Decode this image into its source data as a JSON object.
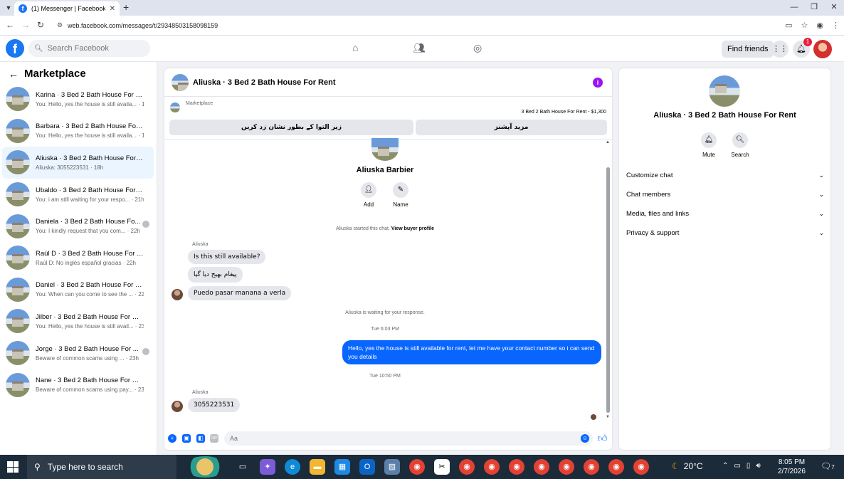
{
  "browser": {
    "tab_title": "(1) Messenger | Facebook",
    "url": "web.facebook.com/messages/t/29348503158098159"
  },
  "header": {
    "search_placeholder": "Search Facebook",
    "find_friends": "Find friends",
    "notification_count": "1"
  },
  "sidebar": {
    "title": "Marketplace",
    "conversations": [
      {
        "name": "Karina · 3 Bed 2 Bath House For Re...",
        "preview": "You: Hello, yes the house is still availa... · 1m",
        "active": false
      },
      {
        "name": "Barbara · 3 Bed 2 Bath House For ...",
        "preview": "You: Hello, yes the house is still availa... · 1m",
        "active": false
      },
      {
        "name": "Aliuska · 3 Bed 2 Bath House For R...",
        "preview": "Aliuska: 3055223531 · 18h",
        "active": true
      },
      {
        "name": "Ubaldo · 3 Bed 2 Bath House For R...",
        "preview": "You: i am still waiting for your respo... · 21h",
        "active": false
      },
      {
        "name": "Daniela · 3 Bed 2 Bath House Fo...",
        "preview": "You: I kindly request that you com... · 22h",
        "active": false
      },
      {
        "name": "Raúl D · 3 Bed 2 Bath House For R...",
        "preview": "Raúl D: No inglés español gracias · 22h",
        "active": false
      },
      {
        "name": "Daniel · 3 Bed 2 Bath House For Re...",
        "preview": "You: When can you come to see the ... · 22h",
        "active": false
      },
      {
        "name": "Jilber · 3 Bed 2 Bath House For Rent",
        "preview": "You: Hello, yes the house is still avail... · 23h",
        "active": false
      },
      {
        "name": "Jorge · 3 Bed 2 Bath House For ...",
        "preview": "Beware of common scams using ... · 23h",
        "active": false
      },
      {
        "name": "Nane · 3 Bed 2 Bath House For Rent",
        "preview": "Beware of common scams using pay... · 23h",
        "active": false
      }
    ]
  },
  "chat": {
    "title": "Aliuska · 3 Bed 2 Bath House For Rent",
    "marketplace_label": "Marketplace",
    "listing": "3 Bed 2 Bath House For Rent - $1,300",
    "btn_mark_sold": "زیر التوا کے بطور نشان زد کریں",
    "btn_more_options": "مزید آپشنز",
    "profile_name": "Aliuska Barbier",
    "action_add": "Add",
    "action_name": "Name",
    "started_note": "Aliuska started this chat.",
    "view_buyer_profile": "View buyer profile",
    "sender1": "Aliuska",
    "msg1": "Is this still available?",
    "msg2": "پیغام بھیج دیا گیا",
    "msg3": "Puedo pasar manana a verla",
    "waiting_note": "Aliuska is waiting for your response.",
    "time1": "Tue 6:03 PM",
    "out_msg": "Hello, yes the house is still available for rent, let me have your contact number so i can send you  details",
    "time2": "Tue 10:50 PM",
    "sender2": "Aliuska",
    "msg4": "3055223531",
    "composer_placeholder": "Aa"
  },
  "right_panel": {
    "title": "Aliuska · 3 Bed 2 Bath House For Rent",
    "mute": "Mute",
    "search": "Search",
    "sections": [
      "Customize chat",
      "Chat members",
      "Media, files and links",
      "Privacy & support"
    ]
  },
  "taskbar": {
    "search_placeholder": "Type here to search",
    "temperature": "20°C",
    "time": "8:05 PM",
    "date": "2/7/2026",
    "notif_count": "7"
  }
}
